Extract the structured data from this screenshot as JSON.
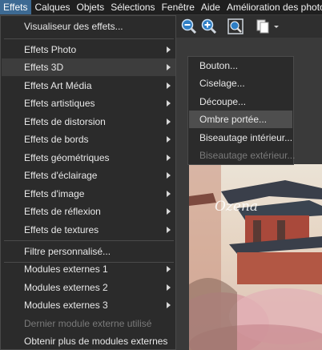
{
  "menubar": {
    "items": [
      {
        "label": "Effets"
      },
      {
        "label": "Calques"
      },
      {
        "label": "Objets"
      },
      {
        "label": "Sélections"
      },
      {
        "label": "Fenêtre"
      },
      {
        "label": "Aide"
      },
      {
        "label": "Amélioration des photos"
      }
    ]
  },
  "effects_menu": {
    "items": [
      {
        "label": "Visualiseur des effets..."
      },
      {
        "label": "Effets Photo"
      },
      {
        "label": "Effets 3D"
      },
      {
        "label": "Effets Art Média"
      },
      {
        "label": "Effets artistiques"
      },
      {
        "label": "Effets de distorsion"
      },
      {
        "label": "Effets de bords"
      },
      {
        "label": "Effets géométriques"
      },
      {
        "label": "Effets d'éclairage"
      },
      {
        "label": "Effets d'image"
      },
      {
        "label": "Effets de réflexion"
      },
      {
        "label": "Effets de textures"
      },
      {
        "label": "Filtre personnalisé..."
      },
      {
        "label": "Modules externes 1"
      },
      {
        "label": "Modules externes 2"
      },
      {
        "label": "Modules externes 3"
      },
      {
        "label": "Dernier module externe utilisé"
      },
      {
        "label": "Obtenir plus de modules externes"
      }
    ]
  },
  "submenu_3d": {
    "items": [
      {
        "label": "Bouton..."
      },
      {
        "label": "Ciselage..."
      },
      {
        "label": "Découpe..."
      },
      {
        "label": "Ombre portée..."
      },
      {
        "label": "Biseautage intérieur..."
      },
      {
        "label": "Biseautage extérieur..."
      }
    ]
  },
  "canvas": {
    "watermark": "Ozena"
  },
  "colors": {
    "menu_bg": "#2b2b2b",
    "highlight": "#3d6a93",
    "disabled": "#7a7a7a"
  }
}
